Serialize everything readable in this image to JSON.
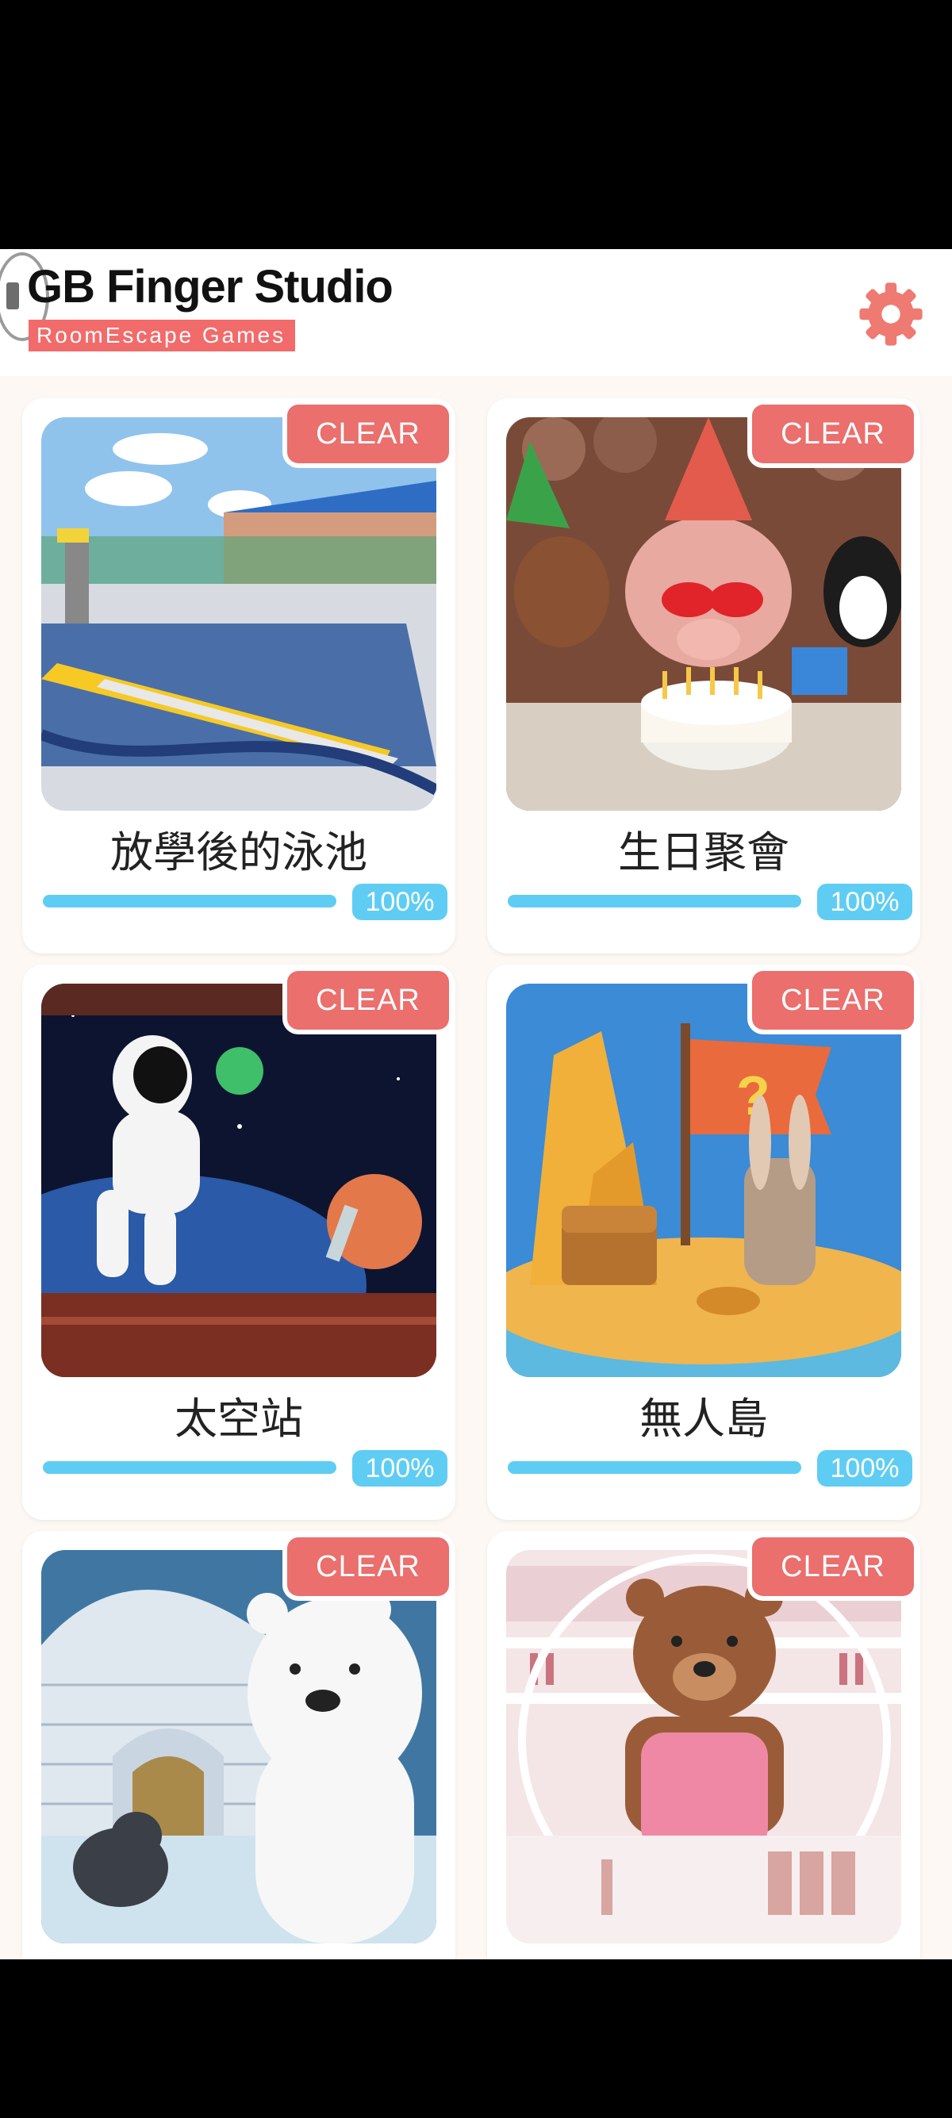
{
  "app": {
    "title": "GB Finger Studio",
    "subtitle": "RoomEscape Games",
    "settings_icon": "gear-icon",
    "accent_color": "#f26b6b",
    "progress_color": "#5fcdf3"
  },
  "levels": [
    {
      "title": "放學後的泳池",
      "badge": "CLEAR",
      "progress_text": "100%",
      "progress": 1.0
    },
    {
      "title": "生日聚會",
      "badge": "CLEAR",
      "progress_text": "100%",
      "progress": 1.0
    },
    {
      "title": "太空站",
      "badge": "CLEAR",
      "progress_text": "100%",
      "progress": 1.0
    },
    {
      "title": "無人島",
      "badge": "CLEAR",
      "progress_text": "100%",
      "progress": 1.0
    },
    {
      "badge": "CLEAR"
    },
    {
      "badge": "CLEAR"
    }
  ]
}
